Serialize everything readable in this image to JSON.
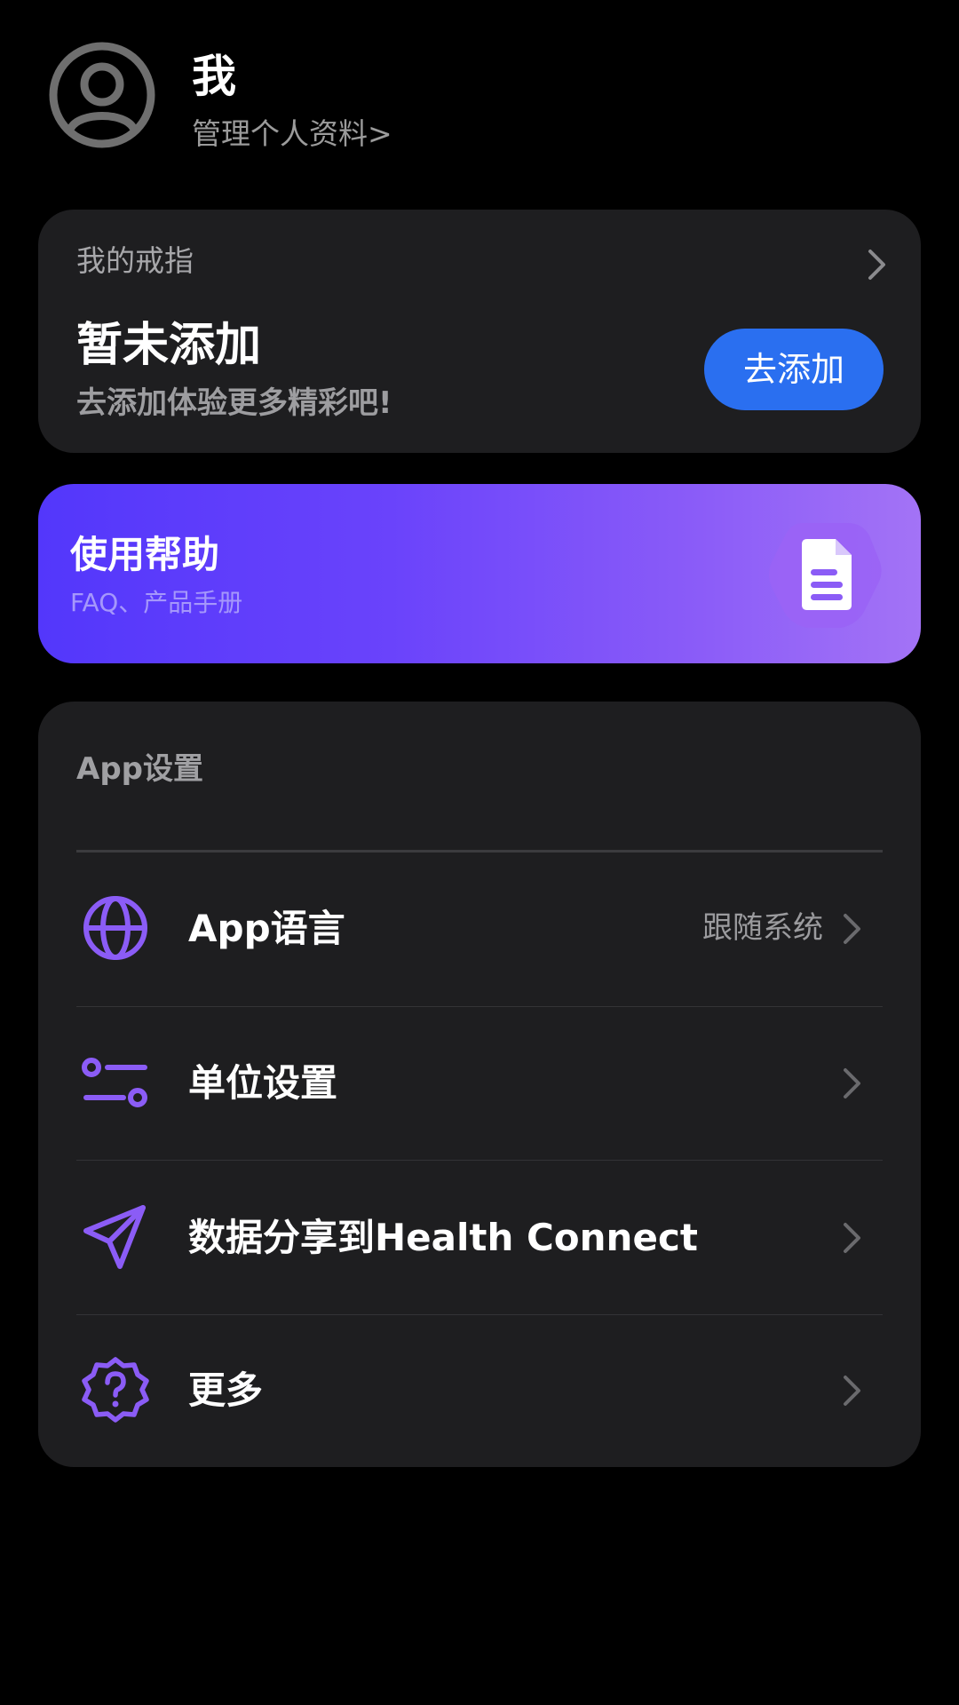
{
  "profile": {
    "name": "我",
    "manage_link": "管理个人资料>"
  },
  "ring_card": {
    "title": "我的戒指",
    "status": "暂未添加",
    "tip": "去添加体验更多精彩吧!",
    "add_button": "去添加"
  },
  "help_banner": {
    "title": "使用帮助",
    "subtitle": "FAQ、产品手册"
  },
  "settings": {
    "section_title": "App设置",
    "items": [
      {
        "label": "App语言",
        "value": "跟随系统",
        "icon": "globe-icon"
      },
      {
        "label": "单位设置",
        "value": "",
        "icon": "sliders-icon"
      },
      {
        "label": "数据分享到Health Connect",
        "value": "",
        "icon": "send-icon"
      },
      {
        "label": "更多",
        "value": "",
        "icon": "help-badge-icon"
      }
    ]
  },
  "colors": {
    "accent_blue": "#2a6ff0",
    "icon_purple": "#8b5cf6",
    "card_bg": "#1e1e20"
  }
}
